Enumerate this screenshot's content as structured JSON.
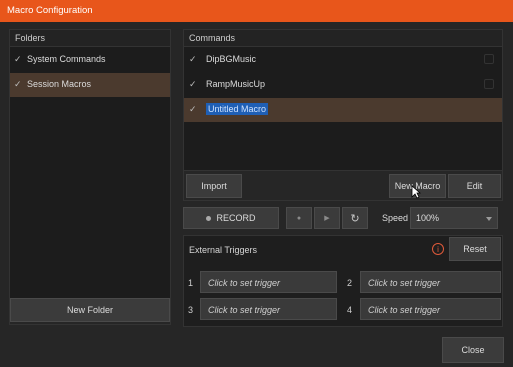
{
  "window": {
    "title": "Macro Configuration"
  },
  "folders": {
    "header": "Folders",
    "items": [
      {
        "label": "System Commands",
        "checked": true,
        "selected": false
      },
      {
        "label": "Session Macros",
        "checked": true,
        "selected": true
      }
    ],
    "new_folder_label": "New Folder"
  },
  "commands": {
    "header": "Commands",
    "items": [
      {
        "label": "DipBGMusic",
        "checked": true,
        "selected": false
      },
      {
        "label": "RampMusicUp",
        "checked": true,
        "selected": false
      },
      {
        "label": "Untitled Macro",
        "checked": true,
        "selected": true
      }
    ],
    "import_label": "Import",
    "new_macro_label": "New Macro",
    "edit_label": "Edit"
  },
  "controls": {
    "record_label": "RECORD",
    "speed_label": "Speed",
    "speed_value": "100%"
  },
  "external_triggers": {
    "title": "External Triggers",
    "reset_label": "Reset",
    "triggers": [
      {
        "num": "1",
        "label": "Click to set trigger"
      },
      {
        "num": "2",
        "label": "Click to set trigger"
      },
      {
        "num": "3",
        "label": "Click to set trigger"
      },
      {
        "num": "4",
        "label": "Click to set trigger"
      }
    ]
  },
  "footer": {
    "close_label": "Close"
  },
  "colors": {
    "accent": "#e8561b",
    "selection_row": "#4b3a2e",
    "text_highlight": "#1f5fb5",
    "info": "#e05a3a"
  }
}
